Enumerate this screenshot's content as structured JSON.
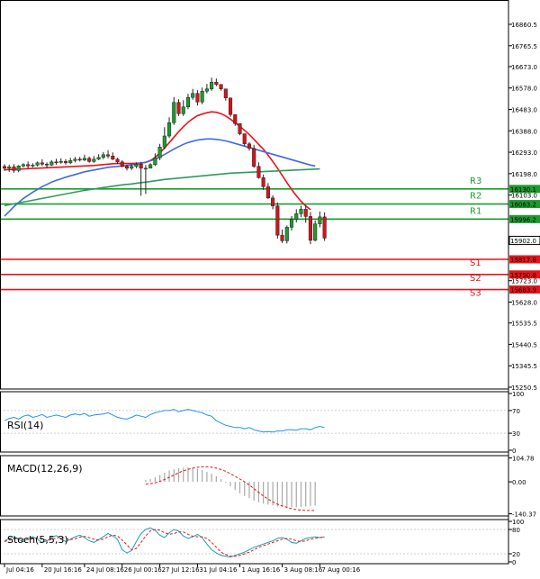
{
  "chart_data": {
    "type": "candlestick",
    "price_axis": {
      "ticks": [
        "16860.5",
        "16765.5",
        "16673.0",
        "16578.0",
        "16483.0",
        "16388.0",
        "16293.0",
        "16198.0",
        "16103.0",
        "15723.0",
        "15628.0",
        "15535.5",
        "15440.5",
        "15345.5",
        "15250.5"
      ],
      "ticks_num": [
        16860.5,
        16765.5,
        16673.0,
        16578.0,
        16483.0,
        16388.0,
        16293.0,
        16198.0,
        16103.0,
        15723.0,
        15628.0,
        15535.5,
        15440.5,
        15345.5,
        15250.5
      ],
      "range": [
        15220,
        16935
      ]
    },
    "x_axis": {
      "ticks": [
        "Jul 04:16",
        "20 Jul 16:16",
        "24 Jul 08:16",
        "26 Jul 00:16",
        "27 Jul 12:16",
        "31 Jul 04:16",
        "1 Aug 16:16",
        "3 Aug 08:16",
        "7 Aug 00:16"
      ],
      "tick_index": [
        0,
        8,
        17,
        25,
        33,
        41,
        50,
        59,
        67
      ]
    },
    "current_price": {
      "value": 15902.0,
      "label": "15902.0"
    },
    "levels": [
      {
        "name": "R3",
        "value": 16130.1,
        "label": "16130.1",
        "color": "#1a9c2e"
      },
      {
        "name": "R2",
        "value": 16063.2,
        "label": "16063.2",
        "color": "#1a9c2e"
      },
      {
        "name": "R1",
        "value": 15996.2,
        "label": "15996.2",
        "color": "#1a9c2e"
      },
      {
        "name": "S1",
        "value": 15817.8,
        "label": "15817.8",
        "color": "#e8131a"
      },
      {
        "name": "S2",
        "value": 15750.8,
        "label": "15750.8",
        "color": "#e8131a"
      },
      {
        "name": "S3",
        "value": 15683.9,
        "label": "15683.9",
        "color": "#e8131a"
      }
    ],
    "candles": {
      "open": [
        16230,
        16222,
        16228,
        16212,
        16232,
        16238,
        16232,
        16236,
        16246,
        16240,
        16236,
        16250,
        16248,
        16252,
        16246,
        16256,
        16262,
        16258,
        16266,
        16252,
        16262,
        16270,
        16282,
        16276,
        16262,
        16250,
        16230,
        16222,
        16230,
        16240,
        16222,
        16222,
        16238,
        16268,
        16316,
        16365,
        16424,
        16514,
        16464,
        16494,
        16536,
        16554,
        16516,
        16564,
        16574,
        16604,
        16594,
        16574,
        16534,
        16460,
        16420,
        16375,
        16330,
        16310,
        16230,
        16180,
        16140,
        16090,
        16055,
        15925,
        15900,
        15960,
        15995,
        16020,
        16040,
        16008,
        15902,
        15975,
        16006
      ],
      "close": [
        16222,
        16228,
        16212,
        16232,
        16238,
        16232,
        16236,
        16246,
        16240,
        16236,
        16250,
        16248,
        16252,
        16246,
        16256,
        16262,
        16258,
        16266,
        16252,
        16262,
        16270,
        16282,
        16276,
        16262,
        16250,
        16230,
        16222,
        16230,
        16240,
        16222,
        16222,
        16238,
        16268,
        16316,
        16365,
        16424,
        16514,
        16464,
        16494,
        16536,
        16554,
        16516,
        16564,
        16574,
        16604,
        16594,
        16574,
        16534,
        16460,
        16420,
        16375,
        16330,
        16310,
        16230,
        16180,
        16140,
        16090,
        16055,
        15925,
        15900,
        15960,
        15995,
        16020,
        16040,
        16008,
        15902,
        15975,
        16006,
        15912
      ],
      "high": [
        16240,
        16238,
        16240,
        16236,
        16244,
        16252,
        16244,
        16252,
        16262,
        16248,
        16258,
        16264,
        16266,
        16262,
        16268,
        16272,
        16272,
        16282,
        16274,
        16276,
        16284,
        16294,
        16302,
        16292,
        16268,
        16258,
        16238,
        16240,
        16248,
        16250,
        16236,
        16244,
        16288,
        16330,
        16404,
        16448,
        16538,
        16528,
        16524,
        16552,
        16574,
        16568,
        16580,
        16596,
        16624,
        16620,
        16594,
        16546,
        16478,
        16446,
        16402,
        16350,
        16338,
        16326,
        16248,
        16194,
        16156,
        16102,
        16070,
        15950,
        15968,
        16010,
        16040,
        16055,
        16056,
        16028,
        15990,
        16030,
        16026
      ],
      "low": [
        16210,
        16206,
        16202,
        16204,
        16226,
        16222,
        16226,
        16230,
        16232,
        16222,
        16232,
        16238,
        16242,
        16238,
        16240,
        16248,
        16252,
        16254,
        16246,
        16246,
        16258,
        16262,
        16266,
        16258,
        16240,
        16226,
        16212,
        16214,
        16222,
        16100,
        16108,
        16222,
        16232,
        16258,
        16306,
        16356,
        16414,
        16454,
        16454,
        16484,
        16526,
        16500,
        16506,
        16554,
        16566,
        16586,
        16566,
        16522,
        16450,
        16410,
        16368,
        16320,
        16300,
        16224,
        16176,
        16126,
        16086,
        16040,
        15910,
        15890,
        15888,
        15945,
        15982,
        16005,
        15980,
        15885,
        15898,
        15960,
        15900
      ]
    },
    "series": [
      {
        "name": "ema_red",
        "color": "#e8131a",
        "values": [
          16215,
          16216,
          16217,
          16218,
          16219,
          16220,
          16221,
          16222,
          16223,
          16224,
          16225,
          16226,
          16227,
          16228,
          16229,
          16230,
          16231,
          16232,
          16233,
          16234,
          16236,
          16238,
          16240,
          16242,
          16243,
          16243,
          16243,
          16243,
          16244,
          16245,
          16248,
          16256,
          16270,
          16290,
          16312,
          16336,
          16360,
          16384,
          16406,
          16426,
          16442,
          16455,
          16462,
          16468,
          16472,
          16470,
          16464,
          16454,
          16440,
          16424,
          16408,
          16390,
          16372,
          16350,
          16328,
          16306,
          16280,
          16252,
          16222,
          16190,
          16158,
          16128,
          16100,
          16075,
          16055,
          16038,
          null,
          null,
          null
        ]
      },
      {
        "name": "ma_blue",
        "color": "#4169e1",
        "values": [
          16010,
          16030,
          16052,
          16070,
          16088,
          16102,
          16116,
          16128,
          16140,
          16150,
          16160,
          16168,
          16175,
          16182,
          16188,
          16194,
          16200,
          16206,
          16210,
          16214,
          16218,
          16222,
          16226,
          16228,
          16230,
          16232,
          16234,
          16237,
          16240,
          16244,
          16249,
          16255,
          16262,
          16272,
          16283,
          16295,
          16307,
          16318,
          16328,
          16336,
          16342,
          16347,
          16350,
          16352,
          16352,
          16350,
          16347,
          16343,
          16338,
          16332,
          16326,
          16320,
          16314,
          16308,
          16302,
          16296,
          16290,
          16284,
          16278,
          16272,
          16266,
          16260,
          16254,
          16248,
          16242,
          16236,
          16232,
          null,
          null
        ]
      },
      {
        "name": "ma_green",
        "color": "#2e9b5c",
        "values": [
          16056,
          16060,
          16064,
          16068,
          16072,
          16076,
          16080,
          16084,
          16088,
          16092,
          16096,
          16100,
          16104,
          16108,
          16112,
          16116,
          16120,
          16124,
          16127,
          16130,
          16133,
          16136,
          16139,
          16142,
          16145,
          16148,
          16150,
          16152,
          16155,
          16158,
          16160,
          16163,
          16166,
          16169,
          16172,
          16174,
          16176,
          16178,
          16180,
          16182,
          16184,
          16186,
          16188,
          16190,
          16192,
          16194,
          16196,
          16198,
          16200,
          16201,
          16202,
          16203,
          16204,
          16205,
          16206,
          16207,
          16208,
          16209,
          16210,
          16211,
          16212,
          16213,
          16214,
          16215,
          16216,
          16217,
          16218,
          16219,
          null
        ]
      }
    ],
    "rsi": {
      "label": "RSI(14)",
      "ticks": [
        "100",
        "70",
        "30",
        "0"
      ],
      "ticks_num": [
        100,
        70,
        30,
        0
      ],
      "values": [
        52,
        56,
        58,
        55,
        60,
        62,
        58,
        60,
        63,
        58,
        60,
        62,
        60,
        58,
        62,
        64,
        62,
        65,
        60,
        62,
        63,
        64,
        66,
        62,
        58,
        56,
        55,
        58,
        62,
        60,
        58,
        63,
        66,
        68,
        70,
        70,
        72,
        68,
        70,
        72,
        70,
        68,
        66,
        62,
        60,
        52,
        48,
        44,
        42,
        40,
        40,
        38,
        40,
        36,
        34,
        32,
        33,
        32,
        34,
        34,
        36,
        36,
        35,
        38,
        38,
        36,
        40,
        42,
        40
      ]
    },
    "macd": {
      "label": "MACD(12,26,9)",
      "ticks": [
        "104.78",
        "0.00",
        "-140.37"
      ],
      "ticks_num": [
        104.78,
        0,
        -140.37
      ],
      "hist": [
        null,
        null,
        null,
        null,
        null,
        null,
        null,
        null,
        null,
        null,
        null,
        null,
        null,
        null,
        null,
        null,
        null,
        null,
        null,
        null,
        null,
        null,
        null,
        null,
        null,
        null,
        null,
        null,
        null,
        null,
        8,
        12,
        20,
        30,
        40,
        50,
        56,
        60,
        62,
        63,
        62,
        58,
        52,
        44,
        36,
        24,
        12,
        -4,
        -20,
        -36,
        -50,
        -62,
        -72,
        -82,
        -90,
        -96,
        -100,
        -104,
        -108,
        -110,
        -112,
        -112,
        -112,
        -110,
        -108,
        -106,
        -104,
        null,
        null
      ],
      "signal": [
        null,
        null,
        null,
        null,
        null,
        null,
        null,
        null,
        null,
        null,
        null,
        null,
        null,
        null,
        null,
        null,
        null,
        null,
        null,
        null,
        null,
        null,
        null,
        null,
        null,
        null,
        null,
        null,
        null,
        null,
        -10,
        -8,
        -4,
        2,
        10,
        20,
        30,
        40,
        48,
        55,
        60,
        64,
        66,
        66,
        64,
        60,
        54,
        46,
        36,
        24,
        12,
        0,
        -14,
        -30,
        -46,
        -62,
        -76,
        -88,
        -98,
        -106,
        -112,
        -118,
        -122,
        -124,
        -126,
        -126,
        -126,
        null,
        null
      ]
    },
    "stoch": {
      "label": "Stoch(5,5,3)",
      "ticks": [
        "100",
        "80",
        "20",
        "0"
      ],
      "ticks_num": [
        100,
        80,
        20,
        0
      ],
      "main": [
        52,
        58,
        62,
        55,
        50,
        58,
        62,
        56,
        48,
        52,
        60,
        65,
        58,
        50,
        56,
        62,
        66,
        60,
        52,
        48,
        55,
        62,
        70,
        64,
        56,
        30,
        22,
        28,
        50,
        70,
        80,
        84,
        78,
        66,
        60,
        72,
        80,
        76,
        64,
        58,
        62,
        68,
        60,
        44,
        30,
        22,
        16,
        14,
        12,
        16,
        20,
        24,
        30,
        36,
        40,
        44,
        48,
        52,
        58,
        60,
        56,
        48,
        46,
        52,
        58,
        60,
        62,
        60,
        62
      ],
      "signal": [
        50,
        54,
        57,
        58,
        56,
        55,
        57,
        59,
        56,
        53,
        55,
        59,
        61,
        58,
        55,
        57,
        61,
        63,
        60,
        56,
        54,
        56,
        62,
        66,
        64,
        54,
        42,
        30,
        33,
        48,
        64,
        77,
        80,
        78,
        72,
        68,
        70,
        74,
        74,
        68,
        63,
        62,
        62,
        58,
        48,
        36,
        24,
        18,
        14,
        14,
        16,
        20,
        24,
        30,
        36,
        40,
        44,
        48,
        52,
        56,
        58,
        56,
        52,
        50,
        52,
        56,
        58,
        60,
        61
      ]
    }
  }
}
